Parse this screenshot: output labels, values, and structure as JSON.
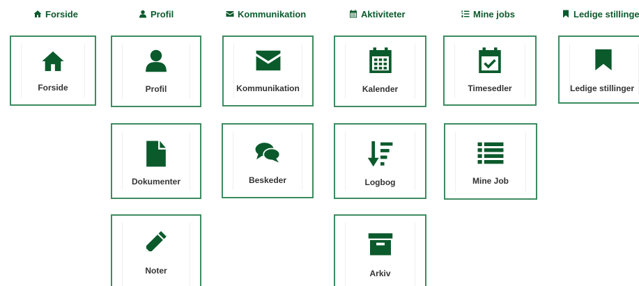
{
  "nav": {
    "items": [
      {
        "label": "Forside",
        "icon": "home-icon"
      },
      {
        "label": "Profil",
        "icon": "user-icon"
      },
      {
        "label": "Kommunikation",
        "icon": "envelope-icon"
      },
      {
        "label": "Aktiviteter",
        "icon": "calendar-icon"
      },
      {
        "label": "Mine jobs",
        "icon": "list-ordered-icon"
      },
      {
        "label": "Ledige stillinger",
        "icon": "bookmark-icon"
      }
    ]
  },
  "tiles": [
    {
      "label": "Forside",
      "icon": "home-icon"
    },
    {
      "label": "Profil",
      "icon": "user-icon"
    },
    {
      "label": "Kommunikation",
      "icon": "envelope-icon"
    },
    {
      "label": "Kalender",
      "icon": "calendar-icon"
    },
    {
      "label": "Timesedler",
      "icon": "calendar-check-icon"
    },
    {
      "label": "Ledige stillinger",
      "icon": "bookmark-icon"
    },
    {
      "label": "Dokumenter",
      "icon": "file-icon"
    },
    {
      "label": "Beskeder",
      "icon": "comments-icon"
    },
    {
      "label": "Logbog",
      "icon": "sort-amount-icon"
    },
    {
      "label": "Mine Job",
      "icon": "list-icon"
    },
    {
      "label": "Noter",
      "icon": "pencil-icon"
    },
    {
      "label": "Arkiv",
      "icon": "archive-icon"
    }
  ],
  "colors": {
    "accent": "#0b5a2c",
    "tile_border": "#3d8b5f",
    "label_text": "#333333"
  }
}
